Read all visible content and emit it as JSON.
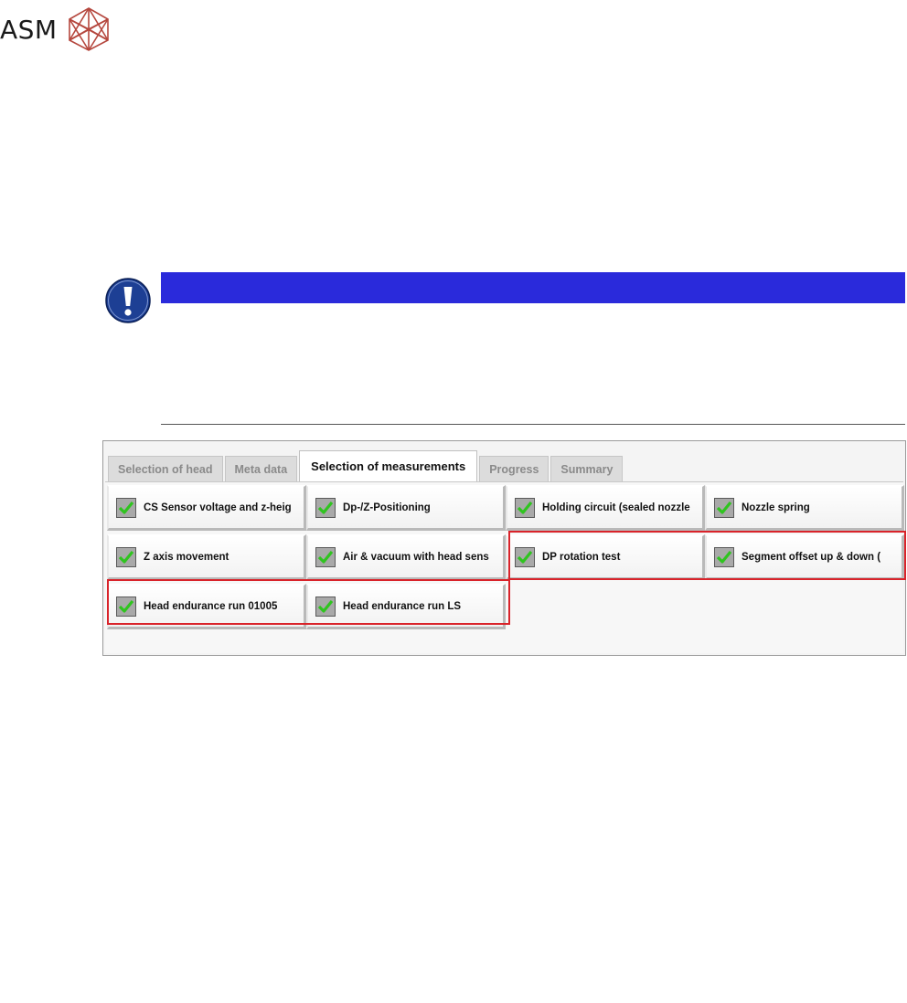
{
  "logo": {
    "text": "ASM"
  },
  "notice": {
    "icon": "exclamation-icon",
    "bar_color": "#2a2adb"
  },
  "app": {
    "tabs": [
      {
        "label": "Selection of head",
        "active": false
      },
      {
        "label": "Meta data",
        "active": false
      },
      {
        "label": "Selection of measurements",
        "active": true
      },
      {
        "label": "Progress",
        "active": false
      },
      {
        "label": "Summary",
        "active": false
      }
    ],
    "measurements": [
      {
        "label": "CS Sensor voltage and z-heig",
        "checked": true
      },
      {
        "label": "Dp-/Z-Positioning",
        "checked": true
      },
      {
        "label": "Holding circuit (sealed nozzle",
        "checked": true
      },
      {
        "label": "Nozzle spring",
        "checked": true
      },
      {
        "label": "Z axis movement",
        "checked": true
      },
      {
        "label": "Air & vacuum with head sens",
        "checked": true
      },
      {
        "label": "DP rotation test",
        "checked": true
      },
      {
        "label": "Segment offset up & down (",
        "checked": true
      },
      {
        "label": "Head endurance run 01005",
        "checked": true
      },
      {
        "label": "Head endurance run LS",
        "checked": true
      }
    ],
    "highlight_color": "#d9232a",
    "check_color": "#2fc41f"
  }
}
